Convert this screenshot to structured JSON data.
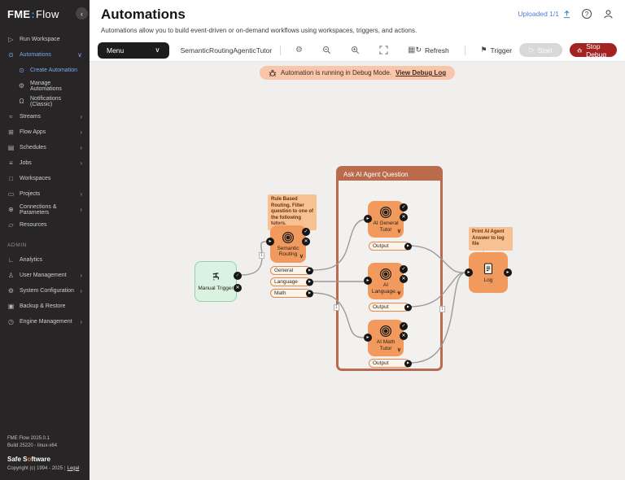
{
  "app": {
    "logo_fme": "FME",
    "logo_colon": ":",
    "logo_flow": "Flow",
    "collapse_glyph": "‹"
  },
  "sidebar": {
    "items": [
      {
        "label": "Run Workspace",
        "icon": "play-icon",
        "chevron": ""
      },
      {
        "label": "Automations",
        "icon": "nodes-icon",
        "chevron": "∨",
        "active": true
      },
      {
        "label": "Create Automation",
        "icon": "nodes-icon",
        "chevron": "",
        "active": true,
        "sub": true
      },
      {
        "label": "Manage Automations",
        "icon": "gear-icon",
        "chevron": "",
        "sub": true
      },
      {
        "label": "Notifications (Classic)",
        "icon": "bell-icon",
        "chevron": "",
        "sub": true
      },
      {
        "label": "Streams",
        "icon": "streams-icon",
        "chevron": "›"
      },
      {
        "label": "Flow Apps",
        "icon": "apps-icon",
        "chevron": "›"
      },
      {
        "label": "Schedules",
        "icon": "calendar-icon",
        "chevron": "›"
      },
      {
        "label": "Jobs",
        "icon": "list-icon",
        "chevron": "›"
      },
      {
        "label": "Workspaces",
        "icon": "file-icon",
        "chevron": ""
      },
      {
        "label": "Projects",
        "icon": "briefcase-icon",
        "chevron": "›"
      },
      {
        "label": "Connections & Parameters",
        "icon": "plug-icon",
        "chevron": "›"
      },
      {
        "label": "Resources",
        "icon": "folder-icon",
        "chevron": ""
      }
    ],
    "admin_label": "ADMIN",
    "admin_items": [
      {
        "label": "Analytics",
        "icon": "chart-icon",
        "chevron": ""
      },
      {
        "label": "User Management",
        "icon": "user-icon",
        "chevron": "›"
      },
      {
        "label": "System Configuration",
        "icon": "gear-icon",
        "chevron": "›"
      },
      {
        "label": "Backup & Restore",
        "icon": "disk-icon",
        "chevron": ""
      },
      {
        "label": "Engine Management",
        "icon": "engine-icon",
        "chevron": "›"
      }
    ],
    "footer": {
      "version": "FME Flow 2025.0.1",
      "build": "Build 25220 - linux-x64",
      "brand_pre": "Safe S",
      "brand_dot": "o",
      "brand_post": "ftware",
      "copyright": "Copyright (c) 1994 - 2025",
      "legal_link": "Legal"
    }
  },
  "header": {
    "title": "Automations",
    "description": "Automations allow you to build event-driven or on-demand workflows using workspaces, triggers, and actions.",
    "uploaded_label": "Uploaded 1/1"
  },
  "toolbar": {
    "menu_label": "Menu",
    "workspace_name": "SemanticRoutingAgenticTutor",
    "icons": [
      "gear-icon",
      "zoom-out-icon",
      "zoom-in-icon",
      "fit-view-icon",
      "grid-icon"
    ],
    "refresh_label": "Refresh",
    "trigger_label": "Trigger",
    "start_label": "Start",
    "stop_debug_label": "Stop Debug"
  },
  "banner": {
    "text": "Automation is running in Debug Mode.",
    "link": "View Debug Log"
  },
  "canvas": {
    "group_title": "Ask AI Agent Question",
    "annotations": [
      {
        "text": "Rule Based Routing. Filter question to one of the following tutors."
      },
      {
        "text": "Print AI Agent Answer to log file"
      }
    ],
    "nodes": [
      {
        "label": "Manual Trigger"
      },
      {
        "label": "Semantic Routing"
      },
      {
        "label": "AI General Tutor"
      },
      {
        "label": "AI Language..."
      },
      {
        "label": "AI Math Tutor"
      },
      {
        "label": "Log"
      }
    ],
    "pills": {
      "general": "General",
      "language": "Language",
      "math": "Math",
      "output1": "Output",
      "output2": "Output",
      "output3": "Output"
    },
    "badges": {
      "b1": "1",
      "b2": "1",
      "b3": "1"
    }
  },
  "colors": {
    "node_orange": "#f29a5d",
    "node_green": "#daf2e2",
    "group_brown": "#b96b4c",
    "banner_peach": "#f8c7ab",
    "annotation_peach": "#f7c192",
    "stop_red": "#a32323",
    "accent_blue": "#4d7ed3",
    "sidebar_dark": "#272525",
    "canvas_grey": "#f0efed"
  }
}
